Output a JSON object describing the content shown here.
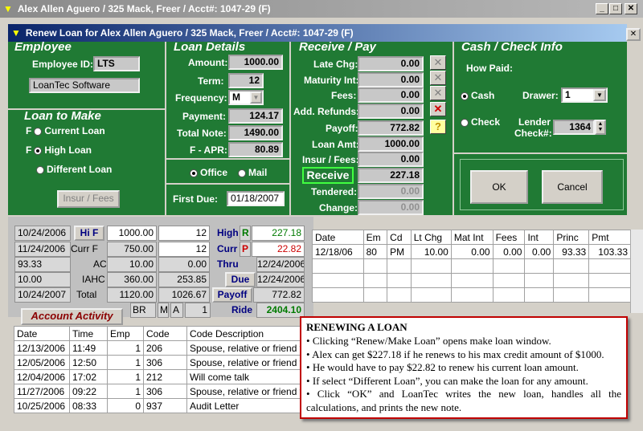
{
  "outer_title": "Alex Allen Aguero / 325 Mack, Freer / Acct#: 1047-29 (F)",
  "inner_title": "Renew Loan for Alex Allen Aguero / 325 Mack, Freer / Acct#: 1047-29 (F)",
  "employee": {
    "section": "Employee",
    "id_label": "Employee ID:",
    "id_value": "LTS",
    "company": "LoanTec Software"
  },
  "loan_to_make": {
    "section": "Loan to Make",
    "options": [
      {
        "prefix": "F",
        "label": "Current Loan",
        "selected": false
      },
      {
        "prefix": "F",
        "label": "High Loan",
        "selected": true
      },
      {
        "prefix": "",
        "label": "Different Loan",
        "selected": false
      }
    ],
    "insur_button": "Insur / Fees"
  },
  "loan_details": {
    "section": "Loan Details",
    "amount_label": "Amount:",
    "amount": "1000.00",
    "term_label": "Term:",
    "term": "12",
    "frequency_label": "Frequency:",
    "frequency": "M",
    "payment_label": "Payment:",
    "payment": "124.17",
    "total_note_label": "Total Note:",
    "total_note": "1490.00",
    "apr_label": "F - APR:",
    "apr": "80.89",
    "office_label": "Office",
    "mail_label": "Mail",
    "first_due_label": "First Due:",
    "first_due": "01/18/2007"
  },
  "receive_pay": {
    "section": "Receive / Pay",
    "late_chg_label": "Late Chg:",
    "late_chg": "0.00",
    "maturity_label": "Maturity Int:",
    "maturity": "0.00",
    "fees_label": "Fees:",
    "fees": "0.00",
    "refunds_label": "Add. Refunds:",
    "refunds": "0.00",
    "payoff_label": "Payoff:",
    "payoff": "772.82",
    "loan_amt_label": "Loan Amt:",
    "loan_amt": "1000.00",
    "insur_label": "Insur / Fees:",
    "insur": "0.00",
    "receive_label": "Receive",
    "receive": "227.18",
    "tendered_label": "Tendered:",
    "tendered": "0.00",
    "change_label": "Change:",
    "change": "0.00"
  },
  "cash_info": {
    "section": "Cash / Check Info",
    "how_paid": "How Paid:",
    "cash": "Cash",
    "check": "Check",
    "drawer_label": "Drawer:",
    "drawer": "1",
    "lender_label1": "Lender",
    "lender_label2": "Check#:",
    "lender_check": "1364",
    "ok": "OK",
    "cancel": "Cancel"
  },
  "summary": {
    "col1": [
      "10/24/2006",
      "11/24/2006",
      "93.33",
      "10.00",
      "10/24/2007"
    ],
    "tags": [
      "Hi F",
      "Curr F",
      "AC",
      "IAHC",
      "Total"
    ],
    "col3": [
      "1000.00",
      "750.00",
      "10.00",
      "360.00",
      "1120.00"
    ],
    "col4": [
      "12",
      "12",
      "0.00",
      "253.85",
      "1026.67"
    ],
    "bottom": [
      "BR",
      "M",
      "A",
      "1"
    ],
    "right_tags": [
      "High",
      "Curr",
      "Thru",
      "Due",
      "Payoff",
      "Ride"
    ],
    "high_letter": "R",
    "curr_letter": "P",
    "right_vals": [
      "227.18",
      "22.82",
      "12/24/2006",
      "12/24/2006",
      "772.82",
      "2404.10"
    ]
  },
  "ledger": {
    "headers": [
      "Date",
      "Em",
      "Cd",
      "Lt Chg",
      "Mat Int",
      "Fees",
      "Int",
      "Princ",
      "Pmt"
    ],
    "rows": [
      [
        "12/18/06",
        "80",
        "PM",
        "10.00",
        "0.00",
        "0.00",
        "0.00",
        "93.33",
        "103.33"
      ]
    ]
  },
  "activity": {
    "button": "Account Activity",
    "headers": [
      "Date",
      "Time",
      "Emp",
      "Code",
      "Code Description"
    ],
    "rows": [
      [
        "12/13/2006",
        "11:49",
        "1",
        "206",
        "Spouse, relative or friend w/"
      ],
      [
        "12/05/2006",
        "12:50",
        "1",
        "306",
        "Spouse, relative or friend w/"
      ],
      [
        "12/04/2006",
        "17:02",
        "1",
        "212",
        "Will come talk"
      ],
      [
        "11/27/2006",
        "09:22",
        "1",
        "306",
        "Spouse, relative or friend w/"
      ],
      [
        "10/25/2006",
        "08:33",
        "0",
        "937",
        "Audit Letter"
      ]
    ]
  },
  "callout": {
    "title": "RENEWING A LOAN",
    "items": [
      "Clicking “Renew/Make Loan” opens make loan window.",
      "Alex can get $227.18 if he renews to his max credit amount of $1000.",
      "He would have to pay $22.82 to renew his current loan amount.",
      "If select “Different Loan”, you can make the loan for any amount.",
      "Click “OK” and LoanTec writes the new loan, handles all the calculations, and prints the new note."
    ]
  },
  "colors": {
    "panel": "#207a34",
    "title_active": "#0a246a",
    "high_red": "#cc0000",
    "green_text": "#007a00"
  }
}
